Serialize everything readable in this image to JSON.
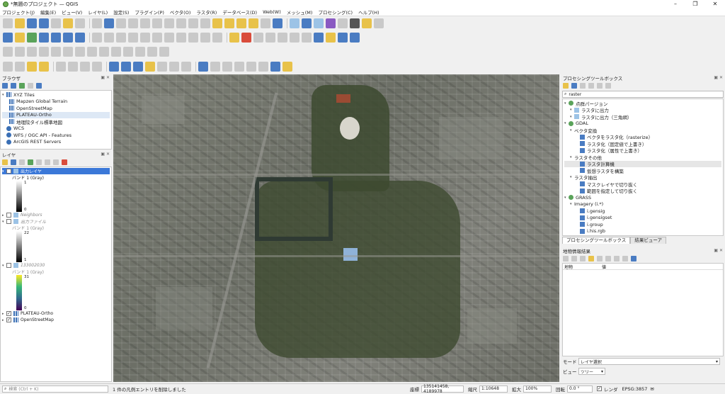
{
  "window": {
    "title": "*無題のプロジェクト — QGIS"
  },
  "menu": [
    "プロジェクト(J)",
    "編集(E)",
    "ビュー(V)",
    "レイヤ(L)",
    "設定(S)",
    "プラグイン(P)",
    "ベクタ(O)",
    "ラスタ(R)",
    "データベース(D)",
    "Web(W)",
    "メッシュ(M)",
    "プロセシング(C)",
    "ヘルプ(H)"
  ],
  "browser": {
    "title": "ブラウザ",
    "items": [
      "XYZ Tiles",
      "Mapzen Global Terrain",
      "OpenStreetMap",
      "PLATEAU-Ortho",
      "地理院タイル標準地図",
      "WCS",
      "WFS / OGC API - Features",
      "ArcGIS REST Servers"
    ]
  },
  "layers": {
    "title": "レイヤ",
    "items": [
      {
        "name": "出力レイヤ",
        "checked": true,
        "band": "バンド 1 (Gray)",
        "max": "1",
        "min": "0"
      },
      {
        "name": "Neighbors",
        "checked": false
      },
      {
        "name": "出力ファイル",
        "checked": false,
        "band": "バンド 1 (Gray)",
        "max": "22",
        "min": "1"
      },
      {
        "name": "133002030",
        "checked": false,
        "band": "バンド 1 (Gray)",
        "max": "31",
        "min": "0"
      },
      {
        "name": "PLATEAU-Ortho",
        "checked": true
      },
      {
        "name": "OpenStreetMap",
        "checked": true
      }
    ]
  },
  "processing": {
    "title": "プロセシングツールボックス",
    "search": "raster",
    "tree": [
      {
        "level": 0,
        "label": "点群パージョン"
      },
      {
        "level": 1,
        "label": "ラスタに出力"
      },
      {
        "level": 1,
        "label": "ラスタに出力（三角網）"
      },
      {
        "level": 0,
        "label": "GDAL"
      },
      {
        "level": 1,
        "label": "ベクタ変換"
      },
      {
        "level": 2,
        "label": "ベクタをラスタ化（rasterize）"
      },
      {
        "level": 2,
        "label": "ラスタ化（固定値で上書き）"
      },
      {
        "level": 2,
        "label": "ラスタ化（属性で上書き）"
      },
      {
        "level": 1,
        "label": "ラスタその他"
      },
      {
        "level": 2,
        "label": "ラスタ計算機"
      },
      {
        "level": 2,
        "label": "仮想ラスタを構築"
      },
      {
        "level": 1,
        "label": "ラスタ抽出"
      },
      {
        "level": 2,
        "label": "マスクレイヤで切り抜く"
      },
      {
        "level": 2,
        "label": "範囲を指定して切り抜く"
      },
      {
        "level": 0,
        "label": "GRASS"
      },
      {
        "level": 1,
        "label": "Imagery (i.*)"
      },
      {
        "level": 2,
        "label": "i.gensig"
      },
      {
        "level": 2,
        "label": "i.gensigset"
      },
      {
        "level": 2,
        "label": "i.group"
      },
      {
        "level": 2,
        "label": "i.his.rgb"
      }
    ],
    "tabs": [
      "プロセシングツールボックス",
      "結果ビューア"
    ]
  },
  "identify": {
    "title": "地物情報結果",
    "col_feature": "地物",
    "col_value": "値",
    "mode_label": "モード",
    "mode_value": "レイヤ選択",
    "view_label": "ビュー",
    "view_value": "ツリー"
  },
  "status": {
    "locator_placeholder": "検索 (Ctrl + K)",
    "message": "1 件の凡例エントリを削除しました",
    "coord_label": "座標",
    "coord_value": "135141458, 4189978",
    "scale_label": "縮尺",
    "scale_value": "1:10648",
    "magnifier_label": "拡大",
    "magnifier_value": "100%",
    "rotation_label": "回転",
    "rotation_value": "0.0 °",
    "render_label": "レンダ",
    "crs": "EPSG:3857"
  }
}
